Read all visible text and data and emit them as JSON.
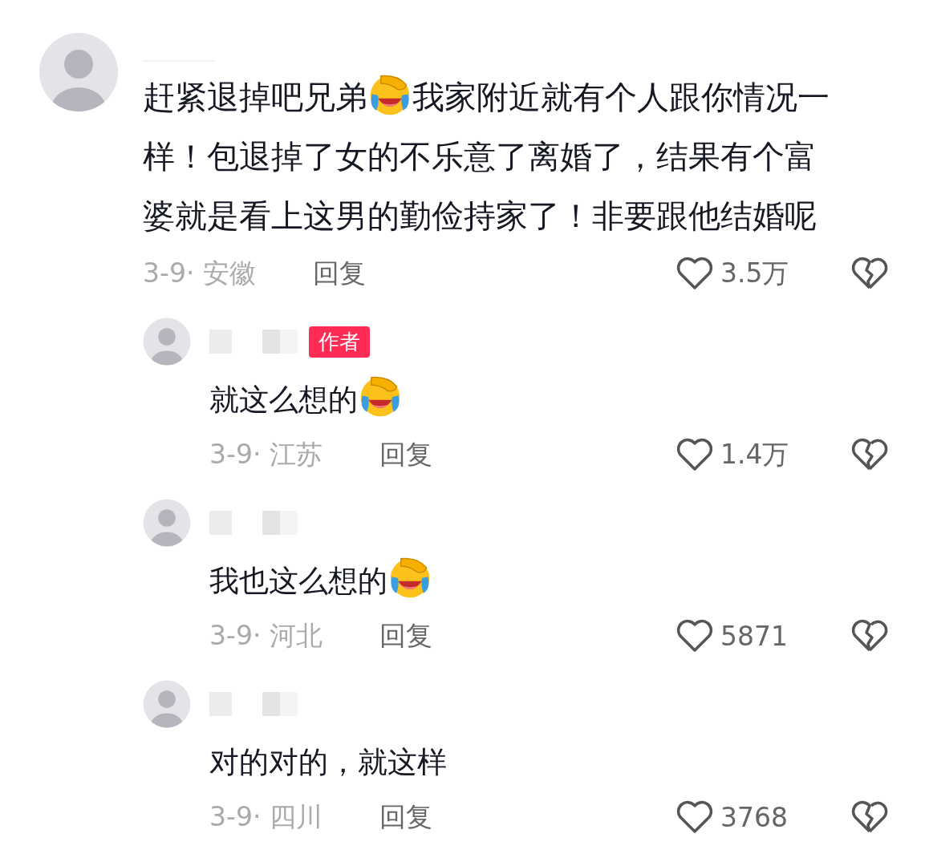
{
  "comment": {
    "lines": [
      [
        {
          "kind": "text",
          "text": "赶紧退掉吧兄弟"
        },
        {
          "kind": "emoji"
        },
        {
          "kind": "text",
          "text": "我家附近就有个人跟你情况一"
        }
      ],
      [
        {
          "kind": "text",
          "text": "样！包退掉了女的不乐意了离婚了，结果有个富"
        }
      ],
      [
        {
          "kind": "text",
          "text": "婆就是看上这男的勤俭持家了！非要跟他结婚呢"
        }
      ]
    ],
    "date": "3-9· 安徽",
    "reply": "回复",
    "likes": "3.5万",
    "children": [
      {
        "badge": "作者",
        "content": [
          {
            "kind": "text",
            "text": "就这么想的"
          },
          {
            "kind": "emoji"
          }
        ],
        "date": "3-9· 江苏",
        "reply": "回复",
        "likes": "1.4万"
      },
      {
        "content": [
          {
            "kind": "text",
            "text": "我也这么想的"
          },
          {
            "kind": "emoji"
          }
        ],
        "date": "3-9· 河北",
        "reply": "回复",
        "likes": "5871"
      },
      {
        "content": [
          {
            "kind": "text",
            "text": "对的对的，就这样"
          }
        ],
        "date": "3-9· 四川",
        "reply": "回复",
        "likes": "3768"
      }
    ]
  }
}
